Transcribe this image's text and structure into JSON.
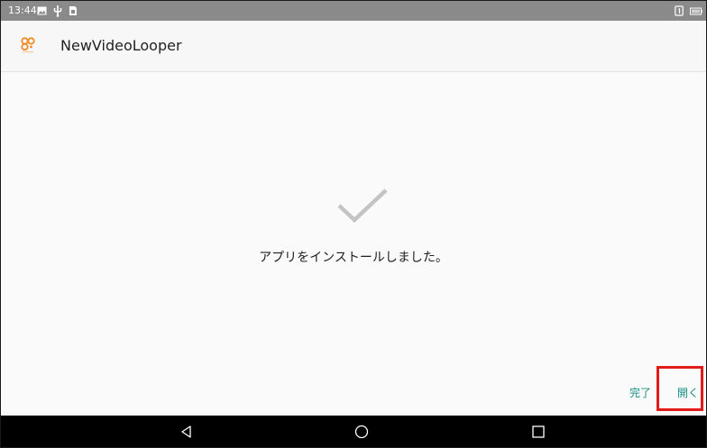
{
  "status_bar": {
    "time": "13:44",
    "icons": [
      "image-icon",
      "usb-icon",
      "sim-card-icon",
      "notification-icon",
      "battery-icon"
    ]
  },
  "app_bar": {
    "icon": "app-logo-icon",
    "title": "NewVideoLooper"
  },
  "main": {
    "status_icon": "checkmark-icon",
    "message": "アプリをインストールしました。"
  },
  "actions": {
    "done_label": "完了",
    "open_label": "開く"
  },
  "nav_bar": {
    "icons": [
      "back-icon",
      "home-icon",
      "recents-icon"
    ]
  },
  "colors": {
    "accent": "#1a8f86",
    "status_bar": "#8a8a8a",
    "nav_bar": "#000000",
    "highlight": "#e21a1a",
    "app_logo": "#f08a24"
  }
}
